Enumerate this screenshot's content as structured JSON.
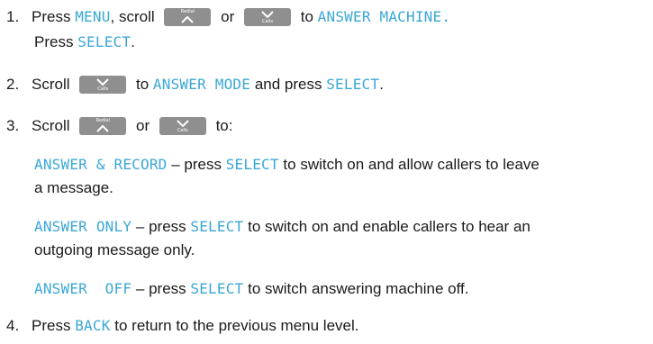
{
  "steps": [
    {
      "number": "1.",
      "press": "Press",
      "menu": "MENU",
      "scroll": ", scroll",
      "or": "or",
      "to": "to",
      "answer_machine": "ANSWER MACHINE.",
      "press2": "Press",
      "select": "SELECT",
      "period": "."
    },
    {
      "number": "2.",
      "scroll": "Scroll",
      "to": "to",
      "answer_mode": "ANSWER MODE",
      "and_press": "and press",
      "select": "SELECT",
      "period": "."
    },
    {
      "number": "3.",
      "scroll": "Scroll",
      "or": "or",
      "to": "to:",
      "options": [
        {
          "lcd": "ANSWER & RECORD",
          "text1": " – press ",
          "select": "SELECT",
          "text2": " to switch on and allow callers to leave",
          "line2": "a message."
        },
        {
          "lcd": "ANSWER ONLY",
          "text1": " – press ",
          "select": "SELECT",
          "text2": " to switch on and enable callers to hear an",
          "line2": "outgoing message only."
        },
        {
          "lcd": "ANSWER  OFF",
          "text1": " – press ",
          "select": "SELECT",
          "text2": " to switch answering machine off."
        }
      ]
    },
    {
      "number": "4.",
      "press": "Press",
      "back": "BACK",
      "rest": "to return to the previous menu level."
    }
  ],
  "keys": {
    "redial_label": "Redial",
    "calls_label": "Calls",
    "redial_icon": "chevron-up-icon",
    "calls_icon": "chevron-down-icon"
  },
  "colors": {
    "lcd_text": "#3aa7d6",
    "key_bg": "#8f8f8f",
    "body_text": "#1a1a1a"
  }
}
